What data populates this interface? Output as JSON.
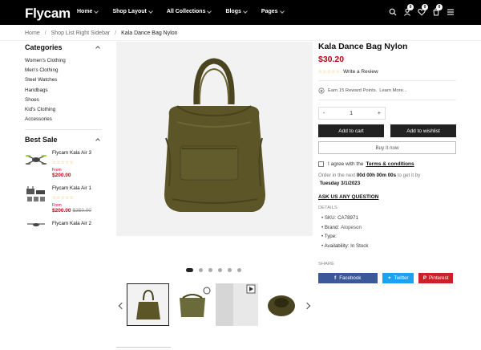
{
  "header": {
    "logo": "Flycam",
    "nav": [
      "Home",
      "Shop Layout",
      "All Collections",
      "Blogs",
      "Pages"
    ],
    "icons": [
      "search-icon",
      "user-icon",
      "heart-icon",
      "compare-icon",
      "cart-icon",
      "menu-icon"
    ],
    "badges": {
      "wishlist": "0",
      "compare": "0",
      "cart": "0"
    }
  },
  "breadcrumb": {
    "items": [
      "Home",
      "Shop List Right Sidebar",
      "Kala Dance Bag Nylon"
    ]
  },
  "sidebar": {
    "categories_title": "Categories",
    "categories": [
      "Women's Clothing",
      "Men's Clothing",
      "Steel Watches",
      "Handbags",
      "Shoes",
      "Kid's Clothing",
      "Accessories"
    ],
    "best_sale_title": "Best Sale",
    "best_sale": [
      {
        "name": "Flycam Kala Air 3",
        "from": "From",
        "price": "$200.00",
        "old": ""
      },
      {
        "name": "Flycam Kala Air 1",
        "from": "From",
        "price": "$200.00",
        "old": "$250.00"
      },
      {
        "name": "Flycam Kala Air 2",
        "from": "",
        "price": "",
        "old": ""
      }
    ]
  },
  "gallery": {
    "dots": 6,
    "active_dot": 0
  },
  "product": {
    "title": "Kala Dance Bag Nylon",
    "price": "$30.20",
    "stars": "☆☆☆☆☆",
    "write_review": "Write a Review",
    "reward": "Earn 15 Reward Points.",
    "learn_more": "Learn More...",
    "qty_minus": "-",
    "qty_value": "1",
    "qty_plus": "+",
    "add_to_cart": "Add to cart",
    "add_to_wishlist": "Add to wishlist",
    "buy_now": "Buy it now",
    "agree_text": "I agree with the",
    "terms": "Terms & conditions",
    "order_prefix": "Order in the next",
    "order_time": "00d 00h 00m 00s",
    "order_mid": "to get it by",
    "order_date": "Tuesday 3/1/2023",
    "ask": "ASK US ANY QUESTION",
    "details_title": "DETAILS",
    "sku_label": "SKU:",
    "sku": "CA78971",
    "brand_label": "Brand:",
    "brand": "Alopeson",
    "type_label": "Type:",
    "type": "",
    "availability_label": "Availability:",
    "availability": "In Stock",
    "share_title": "SHARE",
    "share": [
      "Facebook",
      "Twitter",
      "Pinterest"
    ]
  },
  "colors": {
    "accent": "#c20016",
    "header_bg": "#000000",
    "facebook": "#3b5998",
    "twitter": "#1da1f2",
    "pinterest": "#cb2027",
    "bag": "#5a5426"
  }
}
